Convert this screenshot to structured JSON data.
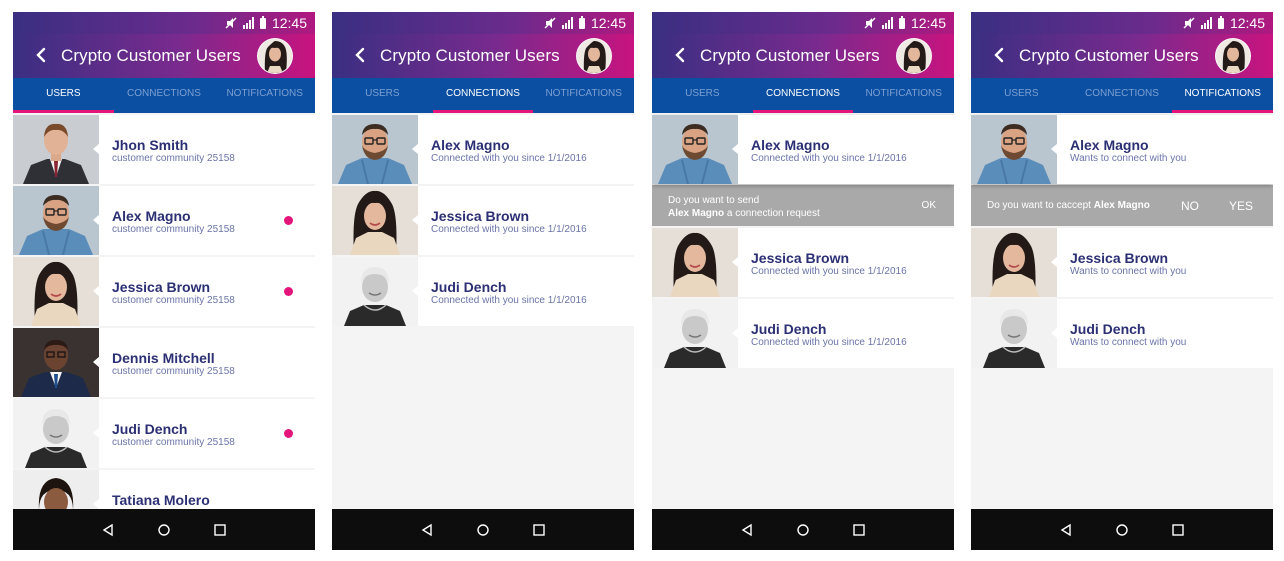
{
  "status": {
    "time": "12:45"
  },
  "app": {
    "title": "Crypto Customer Users"
  },
  "tabs": [
    "USERS",
    "CONNECTIONS",
    "NOTIFICATIONS"
  ],
  "colors": {
    "accent": "#e3157a",
    "tab_bg": "#0a4fa2",
    "name": "#2b2f74",
    "sub": "#6a74a8",
    "navbar": "#0d0d0d",
    "band": "#a9a9a9"
  },
  "screens": [
    {
      "active_tab": "USERS",
      "rows": [
        {
          "name": "Jhon Smith",
          "sub": "customer community 25158",
          "dot": false
        },
        {
          "name": "Alex Magno",
          "sub": "customer community 25158",
          "dot": true
        },
        {
          "name": "Jessica Brown",
          "sub": "customer community 25158",
          "dot": true
        },
        {
          "name": "Dennis Mitchell",
          "sub": "customer community 25158",
          "dot": false
        },
        {
          "name": "Judi Dench",
          "sub": "customer community 25158",
          "dot": true
        },
        {
          "name": "Tatiana Molero",
          "sub": "",
          "dot": false
        }
      ]
    },
    {
      "active_tab": "CONNECTIONS",
      "rows": [
        {
          "name": "Alex Magno",
          "sub": "Connected with you since 1/1/2016"
        },
        {
          "name": "Jessica Brown",
          "sub": "Connected with you since 1/1/2016"
        },
        {
          "name": "Judi Dench",
          "sub": "Connected with you since 1/1/2016"
        }
      ]
    },
    {
      "active_tab": "CONNECTIONS",
      "rows": [
        {
          "name": "Alex Magno",
          "sub": "Connected with you since 1/1/2016"
        },
        {
          "name": "Jessica Brown",
          "sub": "Connected with you since 1/1/2016"
        },
        {
          "name": "Judi Dench",
          "sub": "Connected with you since 1/1/2016"
        }
      ],
      "prompt": {
        "line1": "Do you want to send",
        "name": "Alex Magno",
        "line2": "a connection request",
        "ok": "OK"
      }
    },
    {
      "active_tab": "NOTIFICATIONS",
      "rows": [
        {
          "name": "Alex Magno",
          "sub": "Wants to connect with you"
        },
        {
          "name": "Jessica Brown",
          "sub": "Wants to connect with you"
        },
        {
          "name": "Judi Dench",
          "sub": "Wants to connect with you"
        }
      ],
      "prompt": {
        "text": "Do you want to caccept",
        "name": "Alex Magno",
        "no": "NO",
        "yes": "YES"
      }
    }
  ]
}
